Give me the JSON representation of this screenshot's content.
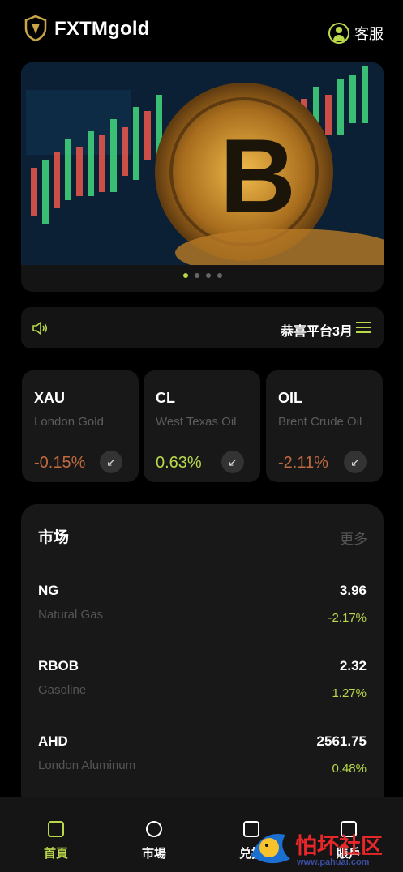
{
  "header": {
    "brand": "FXTMgold",
    "support_label": "客服",
    "logo_icon": "shield-logo-icon",
    "support_icon": "user-circle-icon"
  },
  "banner": {
    "image": "bitcoin-chart-image",
    "slides": 4,
    "active_slide": 1
  },
  "notice": {
    "text": "恭喜平台3月",
    "speaker_icon": "speaker-icon",
    "menu_icon": "menu-icon"
  },
  "tickers": [
    {
      "symbol": "XAU",
      "name": "London Gold",
      "change": "-0.15%",
      "direction": "down"
    },
    {
      "symbol": "CL",
      "name": "West Texas Oil",
      "change": "0.63%",
      "direction": "up"
    },
    {
      "symbol": "OIL",
      "name": "Brent Crude Oil",
      "change": "-2.11%",
      "direction": "down"
    }
  ],
  "market": {
    "title": "市场",
    "more": "更多",
    "rows": [
      {
        "symbol": "NG",
        "name": "Natural Gas",
        "price": "3.96",
        "change": "-2.17%"
      },
      {
        "symbol": "RBOB",
        "name": "Gasoline",
        "price": "2.32",
        "change": "1.27%"
      },
      {
        "symbol": "AHD",
        "name": "London Aluminum",
        "price": "2561.75",
        "change": "0.48%"
      }
    ]
  },
  "nav": {
    "items": [
      {
        "label": "首頁",
        "icon": "home-icon",
        "active": true
      },
      {
        "label": "市場",
        "icon": "chart-icon",
        "active": false
      },
      {
        "label": "兑换",
        "icon": "exchange-icon",
        "active": false
      },
      {
        "label": "賬戶",
        "icon": "account-icon",
        "active": false
      }
    ]
  },
  "colors": {
    "accent": "#b9d84a",
    "negative": "#c1693f",
    "background": "#000000",
    "card": "#181818"
  },
  "watermark": {
    "text": "怕坏社区",
    "url": "www.pahuai.com"
  }
}
